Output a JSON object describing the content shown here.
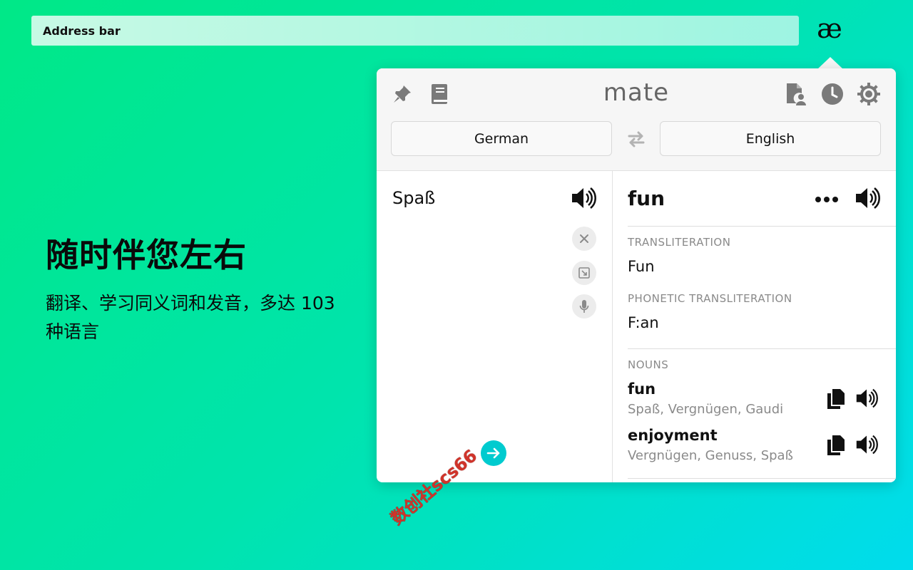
{
  "browser": {
    "address_bar_text": "Address bar",
    "extension_icon": "æ"
  },
  "promo": {
    "headline": "随时伴您左右",
    "subline": "翻译、学习同义词和发音，多达 103 种语言",
    "watermark": "数创社scs66"
  },
  "popup": {
    "app_name": "mate",
    "header_icons": [
      "pin-icon",
      "phrasebook-icon",
      "document-user-icon",
      "history-icon",
      "settings-icon"
    ],
    "source_language": "German",
    "target_language": "English",
    "source": {
      "text": "Spaß",
      "actions": [
        "speaker-icon",
        "clear-icon",
        "expand-icon",
        "microphone-icon",
        "go-arrow-icon"
      ]
    },
    "translation": {
      "word": "fun",
      "transliteration_label": "TRANSLITERATION",
      "transliteration_value": "Fun",
      "phonetic_label": "PHONETIC TRANSLITERATION",
      "phonetic_value": "F:an",
      "nouns_label": "NOUNS",
      "nouns": [
        {
          "word": "fun",
          "synonyms": "Spaß, Vergnügen, Gaudi"
        },
        {
          "word": "enjoyment",
          "synonyms": "Vergnügen, Genuss, Spaß"
        }
      ]
    },
    "colors": {
      "accent": "#00cbcf",
      "background_start": "#00e887",
      "background_end": "#00dced"
    }
  }
}
